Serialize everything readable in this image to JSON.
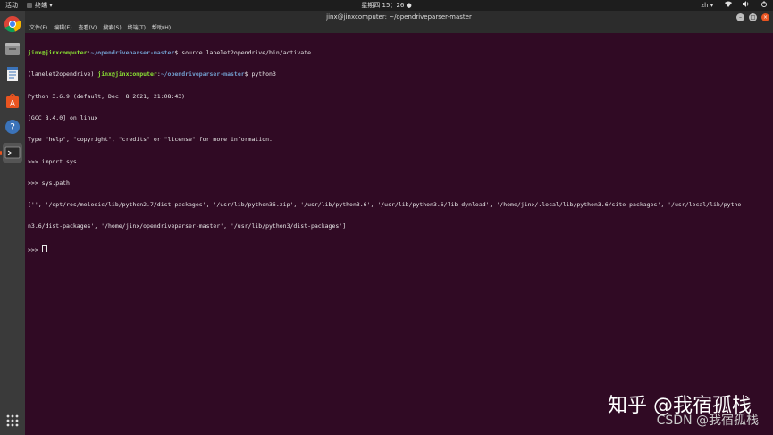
{
  "topbar": {
    "activities": "活动",
    "app_menu": "终端 ▾",
    "clock": "星期四 15：26 ●",
    "input_method": "zh ▾",
    "network_icon": "network-icon",
    "volume_icon": "volume-icon",
    "power_icon": "power-icon"
  },
  "window": {
    "title": "jinx@jinxcomputer: ~/opendriveparser-master"
  },
  "menubar": {
    "items": [
      "文件(F)",
      "编辑(E)",
      "查看(V)",
      "搜索(S)",
      "终端(T)",
      "帮助(H)"
    ]
  },
  "dock": {
    "items": [
      "chrome-icon",
      "files-icon",
      "text-editor-icon",
      "software-center-icon",
      "help-icon",
      "terminal-icon",
      "app-grid-icon"
    ]
  },
  "terminal": {
    "line1": {
      "user": "jinx@jinxcomputer",
      "sep": ":",
      "path": "~/opendriveparser-master",
      "cmd": "$ source lanelet2opendrive/bin/activate"
    },
    "line2": {
      "venv": "(lanelet2opendrive) ",
      "user": "jinx@jinxcomputer",
      "sep": ":",
      "path": "~/opendriveparser-master",
      "cmd": "$ python3"
    },
    "output_lines": [
      "Python 3.6.9 (default, Dec  8 2021, 21:08:43)",
      "[GCC 8.4.0] on linux",
      "Type \"help\", \"copyright\", \"credits\" or \"license\" for more information.",
      ">>> import sys",
      ">>> sys.path",
      "['', '/opt/ros/melodic/lib/python2.7/dist-packages', '/usr/lib/python36.zip', '/usr/lib/python3.6', '/usr/lib/python3.6/lib-dynload', '/home/jinx/.local/lib/python3.6/site-packages', '/usr/local/lib/pytho",
      "n3.6/dist-packages', '/home/jinx/opendriveparser-master', '/usr/lib/python3/dist-packages']"
    ],
    "prompt": ">>> "
  },
  "watermark": {
    "zhihu": "知乎 @我宿孤栈",
    "csdn": "CSDN @我宿孤栈"
  }
}
